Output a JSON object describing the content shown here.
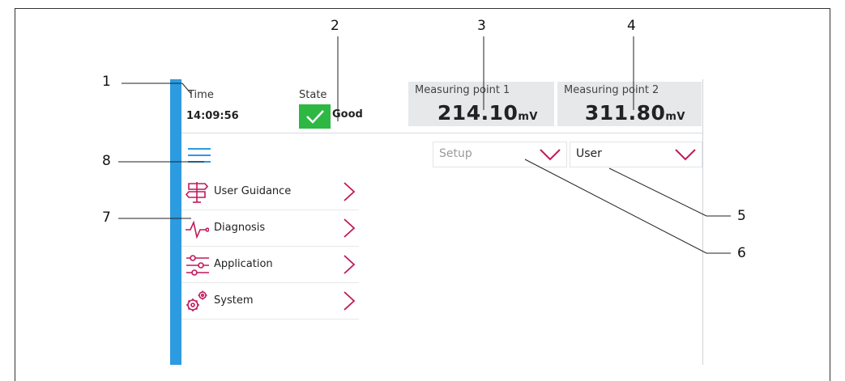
{
  "header": {
    "time_label": "Time",
    "time_value": "14:09:56",
    "state_label": "State",
    "state_value": "Good"
  },
  "measuring_points": [
    {
      "label": "Measuring point 1",
      "value": "214.10",
      "unit": "mV"
    },
    {
      "label": "Measuring point 2",
      "value": "311.80",
      "unit": "mV"
    }
  ],
  "toolbar": {
    "setup_dropdown": "Setup",
    "user_dropdown": "User"
  },
  "menu": {
    "items": [
      {
        "label": "User Guidance",
        "icon": "signpost-icon"
      },
      {
        "label": "Diagnosis",
        "icon": "pulse-icon"
      },
      {
        "label": "Application",
        "icon": "sliders-icon"
      },
      {
        "label": "System",
        "icon": "gears-icon"
      }
    ]
  },
  "callouts": [
    "1",
    "2",
    "3",
    "4",
    "5",
    "6",
    "7",
    "8"
  ],
  "colors": {
    "accent": "#2d9be0",
    "good": "#2db843",
    "menu_icon": "#c2185b",
    "panel": "#e6e8ea"
  }
}
